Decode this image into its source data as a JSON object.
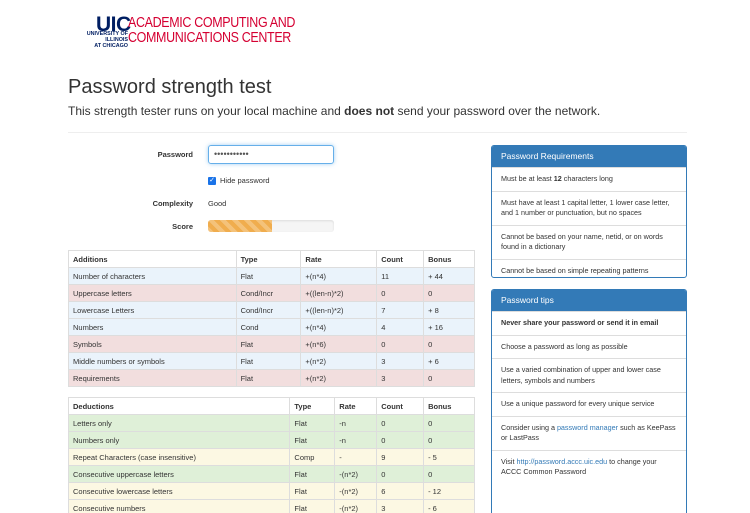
{
  "logo": {
    "uic": "UIC",
    "univ_line1": "UNIVERSITY OF ILLINOIS",
    "univ_line2": "AT CHICAGO",
    "acc_line1": "ACADEMIC COMPUTING AND",
    "acc_line2": "COMMUNICATIONS CENTER"
  },
  "page": {
    "title": "Password strength test",
    "subtitle_pre": "This strength tester runs on your local machine and ",
    "subtitle_bold": "does not",
    "subtitle_post": " send your password over the network."
  },
  "form": {
    "password_label": "Password",
    "password_value": "•••••••••••",
    "hide_label": "Hide password",
    "complexity_label": "Complexity",
    "complexity_value": "Good",
    "score_label": "Score",
    "score_fraction": 0.51
  },
  "additions": {
    "headers": [
      "Additions",
      "Type",
      "Rate",
      "Count",
      "Bonus"
    ],
    "rows": [
      {
        "name": "Number of characters",
        "type": "Flat",
        "rate": "+(n*4)",
        "count": "11",
        "bonus": "+ 44",
        "status": "info"
      },
      {
        "name": "Uppercase letters",
        "type": "Cond/Incr",
        "rate": "+((len-n)*2)",
        "count": "0",
        "bonus": "0",
        "status": "danger"
      },
      {
        "name": "Lowercase Letters",
        "type": "Cond/Incr",
        "rate": "+((len-n)*2)",
        "count": "7",
        "bonus": "+ 8",
        "status": "info"
      },
      {
        "name": "Numbers",
        "type": "Cond",
        "rate": "+(n*4)",
        "count": "4",
        "bonus": "+ 16",
        "status": "info"
      },
      {
        "name": "Symbols",
        "type": "Flat",
        "rate": "+(n*6)",
        "count": "0",
        "bonus": "0",
        "status": "danger"
      },
      {
        "name": "Middle numbers or symbols",
        "type": "Flat",
        "rate": "+(n*2)",
        "count": "3",
        "bonus": "+ 6",
        "status": "info"
      },
      {
        "name": "Requirements",
        "type": "Flat",
        "rate": "+(n*2)",
        "count": "3",
        "bonus": "0",
        "status": "danger"
      }
    ]
  },
  "deductions": {
    "headers": [
      "Deductions",
      "Type",
      "Rate",
      "Count",
      "Bonus"
    ],
    "rows": [
      {
        "name": "Letters only",
        "type": "Flat",
        "rate": "-n",
        "count": "0",
        "bonus": "0",
        "status": "success"
      },
      {
        "name": "Numbers only",
        "type": "Flat",
        "rate": "-n",
        "count": "0",
        "bonus": "0",
        "status": "success"
      },
      {
        "name": "Repeat Characters (case insensitive)",
        "type": "Comp",
        "rate": "-",
        "count": "9",
        "bonus": "- 5",
        "status": "warning"
      },
      {
        "name": "Consecutive uppercase letters",
        "type": "Flat",
        "rate": "-(n*2)",
        "count": "0",
        "bonus": "0",
        "status": "success"
      },
      {
        "name": "Consecutive lowercase letters",
        "type": "Flat",
        "rate": "-(n*2)",
        "count": "6",
        "bonus": "- 12",
        "status": "warning"
      },
      {
        "name": "Consecutive numbers",
        "type": "Flat",
        "rate": "-(n*2)",
        "count": "3",
        "bonus": "- 6",
        "status": "warning"
      }
    ]
  },
  "requirements_panel": {
    "heading": "Password Requirements",
    "item1_pre": "Must be at least ",
    "item1_bold": "12",
    "item1_post": " characters long",
    "item2": "Must have at least 1 capital letter, 1 lower case letter, and 1 number or punctuation, but no spaces",
    "item3": "Cannot be based on your name, netid, or on words found in a dictionary",
    "item4": "Cannot be based on simple repeating patterns"
  },
  "tips_panel": {
    "heading": "Password tips",
    "item1": "Never share your password or send it in email",
    "item2": "Choose a password as long as possible",
    "item3": "Use a varied combination of upper and lower case letters, symbols and numbers",
    "item4": "Use a unique password for every unique service",
    "item5_pre": "Consider using a ",
    "item5_link": "password manager",
    "item5_post": " such as KeePass or LastPass",
    "item6_pre": "Visit ",
    "item6_link": "http://password.accc.uic.edu",
    "item6_post": " to change your ACCC Common Password"
  },
  "colors": {
    "brand_navy": "#001e62",
    "brand_red": "#d50032",
    "panel_blue": "#337ab7",
    "score_orange": "#f0ad4e"
  }
}
